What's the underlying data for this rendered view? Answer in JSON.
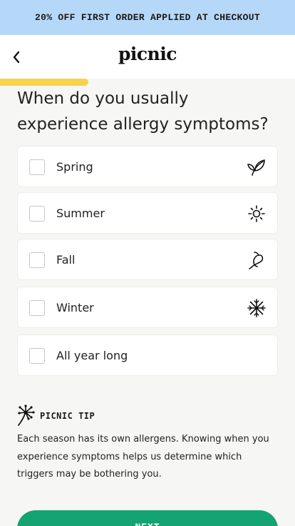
{
  "promo": {
    "text": "20% OFF FIRST ORDER APPLIED AT CHECKOUT"
  },
  "header": {
    "logo": "picnic",
    "back_icon": "chevron-left-icon"
  },
  "progress": {
    "fraction": 0.3
  },
  "question": "When do you usually experience allergy symptoms?",
  "options": [
    {
      "label": "Spring",
      "icon": "leaf-icon",
      "checked": false
    },
    {
      "label": "Summer",
      "icon": "sun-icon",
      "checked": false
    },
    {
      "label": "Fall",
      "icon": "falling-leaf-icon",
      "checked": false
    },
    {
      "label": "Winter",
      "icon": "snowflake-icon",
      "checked": false
    },
    {
      "label": "All year long",
      "icon": "",
      "checked": false
    }
  ],
  "tip": {
    "icon": "dandelion-icon",
    "title": "PICNIC TIP",
    "text": "Each season has its own allergens. Knowing when you experience symptoms helps us determine which triggers may be bothering you."
  },
  "next_button": {
    "label": "NEXT"
  },
  "colors": {
    "promo_bg": "#b6d8f8",
    "progress": "#f7d24a",
    "button": "#14a372",
    "page_bg": "#f6f6f4"
  }
}
